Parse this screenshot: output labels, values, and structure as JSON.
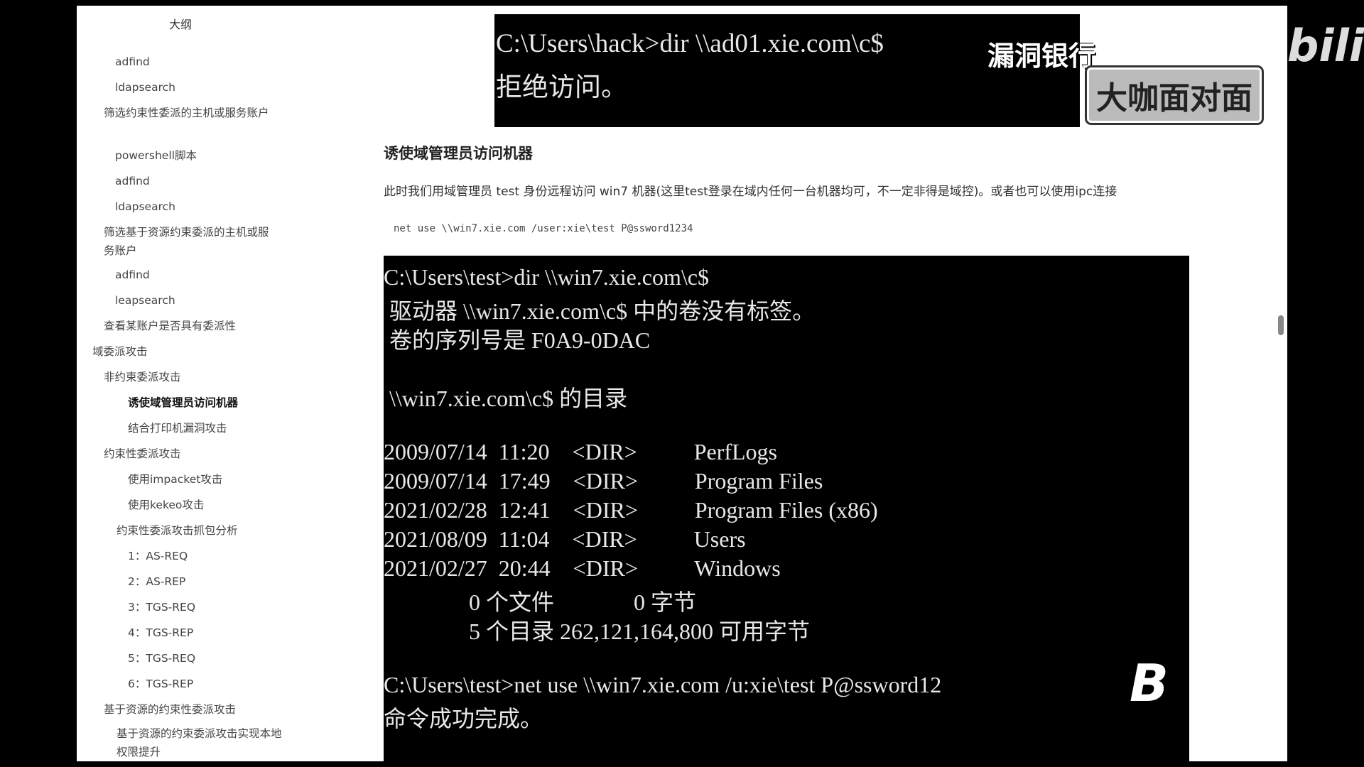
{
  "outline": {
    "title": "大纲",
    "items": [
      {
        "label": "adfind"
      },
      {
        "label": "ldapsearch"
      },
      {
        "label": "筛选约束性委派的主机或服务账户"
      },
      {
        "label": "powershell脚本"
      },
      {
        "label": "adfind"
      },
      {
        "label": "ldapsearch"
      },
      {
        "label": "筛选基于资源约束委派的主机或服务账户"
      },
      {
        "label": "adfind"
      },
      {
        "label": "leapsearch"
      },
      {
        "label": "查看某账户是否具有委派性"
      },
      {
        "label": "域委派攻击"
      },
      {
        "label": "非约束委派攻击"
      },
      {
        "label": "诱使域管理员访问机器"
      },
      {
        "label": "结合打印机漏洞攻击"
      },
      {
        "label": "约束性委派攻击"
      },
      {
        "label": "使用impacket攻击"
      },
      {
        "label": "使用kekeo攻击"
      },
      {
        "label": "约束性委派攻击抓包分析"
      },
      {
        "label": "1：AS-REQ"
      },
      {
        "label": "2：AS-REP"
      },
      {
        "label": "3：TGS-REQ"
      },
      {
        "label": "4：TGS-REP"
      },
      {
        "label": "5：TGS-REQ"
      },
      {
        "label": "6：TGS-REP"
      },
      {
        "label": "基于资源的约束性委派攻击"
      },
      {
        "label": "基于资源的约束委派攻击实现本地权限提升"
      }
    ]
  },
  "terminal_top": {
    "lines": [
      "C:\\Users\\hack>dir \\\\ad01.xie.com\\c$",
      "拒绝访问。"
    ]
  },
  "section": {
    "heading": "诱使域管理员访问机器",
    "paragraph": "此时我们用域管理员 test 身份远程访问 win7 机器(这里test登录在域内任何一台机器均可，不一定非得是域控)。或者也可以使用ipc连接",
    "command": "net use \\\\win7.xie.com /user:xie\\test P@ssword1234"
  },
  "terminal_main": {
    "lines": [
      "C:\\Users\\test>dir \\\\win7.xie.com\\c$",
      " 驱动器 \\\\win7.xie.com\\c$ 中的卷没有标签。",
      " 卷的序列号是 F0A9-0DAC",
      "",
      " \\\\win7.xie.com\\c$ 的目录",
      "",
      "2009/07/14  11:20    <DIR>          PerfLogs",
      "2009/07/14  17:49    <DIR>          Program Files",
      "2021/02/28  12:41    <DIR>          Program Files (x86)",
      "2021/08/09  11:04    <DIR>          Users",
      "2021/02/27  20:44    <DIR>          Windows",
      "               0 个文件              0 字节",
      "               5 个目录 262,121,164,800 可用字节",
      "",
      "C:\\Users\\test>net use \\\\win7.xie.com /u:xie\\test P@ssword12",
      "命令成功完成。"
    ]
  },
  "overlays": {
    "top_text": "漏洞银行",
    "badge": "大咖面对面",
    "bili_logo": "bili",
    "b_logo": "B"
  }
}
